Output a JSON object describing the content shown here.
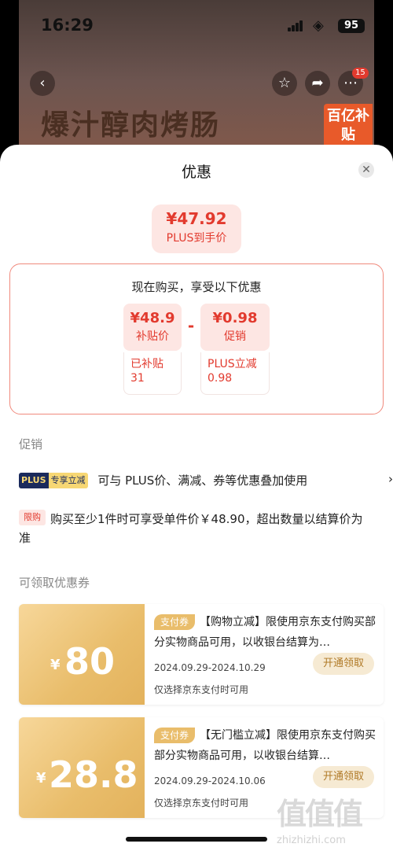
{
  "status_bar": {
    "time": "16:29",
    "battery": "95"
  },
  "product_banner": {
    "title": "爆汁醇肉烤肠",
    "subsidy_tag": "百亿补贴",
    "more_badge": "15"
  },
  "sheet": {
    "title": "优惠",
    "final_price": {
      "amount": "¥47.92",
      "label": "PLUS到手价"
    },
    "breakdown": {
      "heading": "现在购买，享受以下优惠",
      "operator": "-",
      "items": [
        {
          "amount": "¥48.9",
          "label": "补贴价",
          "detail": "已补贴\n31"
        },
        {
          "amount": "¥0.98",
          "label": "促销",
          "detail": "PLUS立减\n0.98"
        }
      ]
    },
    "promotions": {
      "section_label": "促销",
      "items": [
        {
          "tag_part1": "PLUS",
          "tag_part2": "专享立减",
          "text": "可与 PLUS价、满减、券等优惠叠加使用"
        },
        {
          "tag": "限购",
          "text": "购买至少1件时可享受单件价￥48.90，超出数量以结算价为准"
        }
      ]
    },
    "coupons": {
      "section_label": "可领取优惠券",
      "items": [
        {
          "currency": "¥",
          "value": "80",
          "tag": "支付券",
          "title": "【购物立减】限使用京东支付购买部分实物商品可用，以收银台结算为…",
          "date": "2024.09.29-2024.10.29",
          "note": "仅选择京东支付时可用",
          "button": "开通领取"
        },
        {
          "currency": "¥",
          "value": "28.8",
          "tag": "支付券",
          "title": "【无门槛立减】限使用京东支付购买部分实物商品可用，以收银台结算…",
          "date": "2024.09.29-2024.10.06",
          "note": "仅选择京东支付时可用",
          "button": "开通领取"
        }
      ]
    }
  },
  "watermark": {
    "mark": "值值值",
    "site": "zhizhizhi.com"
  },
  "icons": {
    "back": "back-icon",
    "favorite": "star-icon",
    "share": "share-icon",
    "more": "more-icon",
    "close": "close-icon",
    "chevron": "chevron-right-icon"
  },
  "colors": {
    "accent_red": "#e23a2e",
    "coupon_gold": "#e9bd6b",
    "plus_navy": "#1a2a5c"
  }
}
